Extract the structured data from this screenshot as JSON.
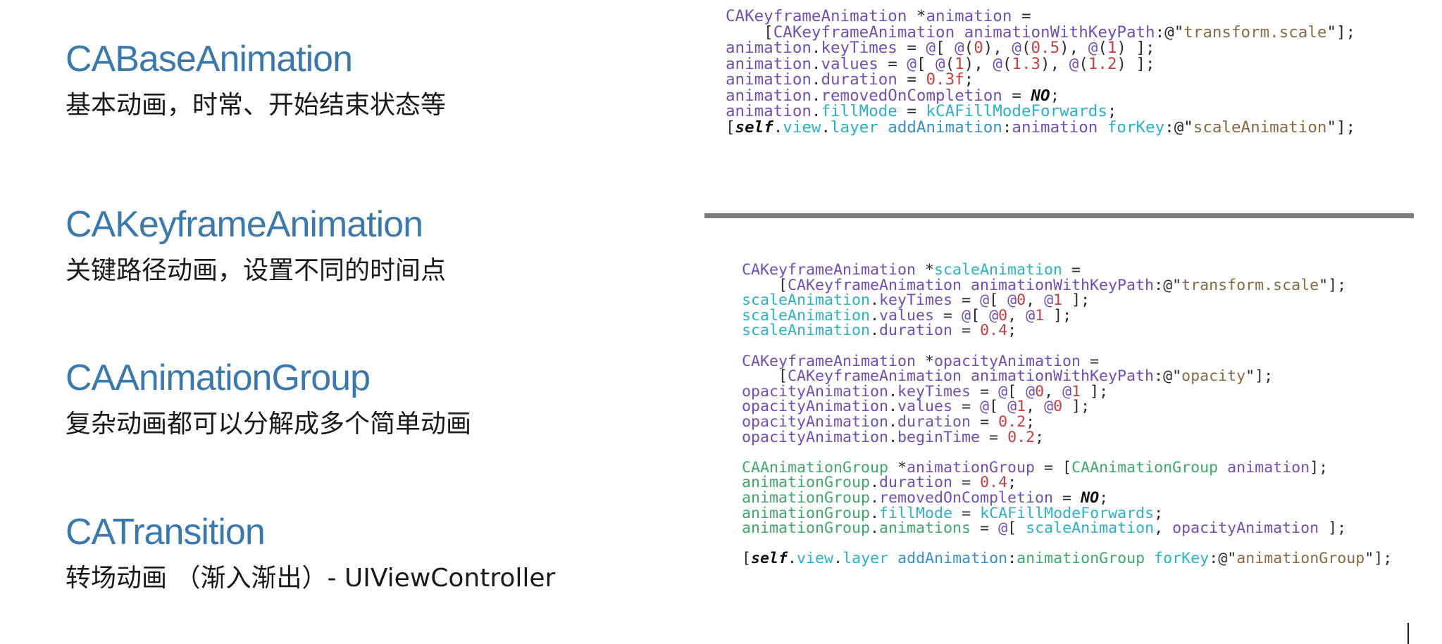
{
  "left_items": [
    {
      "title": "CABaseAnimation",
      "desc": "基本动画，时常、开始结束状态等"
    },
    {
      "title": "CAKeyframeAnimation",
      "desc": "关键路径动画，设置不同的时间点"
    },
    {
      "title": "CAAnimationGroup",
      "desc": "复杂动画都可以分解成多个简单动画"
    },
    {
      "title": "CATransition",
      "desc": "转场动画 （渐入渐出）- UIViewController"
    }
  ],
  "code_top": [
    [
      [
        "type",
        "CAKeyframeAnimation"
      ],
      [
        "plain",
        " *"
      ],
      [
        "type",
        "animation"
      ],
      [
        "plain",
        " ="
      ]
    ],
    [
      [
        "plain",
        "    ["
      ],
      [
        "type",
        "CAKeyframeAnimation"
      ],
      [
        "plain",
        " "
      ],
      [
        "type",
        "animationWithKeyPath"
      ],
      [
        "plain",
        ":@\""
      ],
      [
        "str",
        "transform.scale"
      ],
      [
        "plain",
        "\"];"
      ]
    ],
    [
      [
        "type",
        "animation"
      ],
      [
        "plain",
        "."
      ],
      [
        "type",
        "keyTimes"
      ],
      [
        "plain",
        " = "
      ],
      [
        "type",
        "@"
      ],
      [
        "plain",
        "[ "
      ],
      [
        "type",
        "@"
      ],
      [
        "plain",
        "("
      ],
      [
        "num",
        "0"
      ],
      [
        "plain",
        "), "
      ],
      [
        "type",
        "@"
      ],
      [
        "plain",
        "("
      ],
      [
        "num",
        "0.5"
      ],
      [
        "plain",
        "), "
      ],
      [
        "type",
        "@"
      ],
      [
        "plain",
        "("
      ],
      [
        "num",
        "1"
      ],
      [
        "plain",
        ") ];"
      ]
    ],
    [
      [
        "type",
        "animation"
      ],
      [
        "plain",
        "."
      ],
      [
        "type",
        "values"
      ],
      [
        "plain",
        " = "
      ],
      [
        "type",
        "@"
      ],
      [
        "plain",
        "[ "
      ],
      [
        "type",
        "@"
      ],
      [
        "plain",
        "("
      ],
      [
        "num",
        "1"
      ],
      [
        "plain",
        "), "
      ],
      [
        "type",
        "@"
      ],
      [
        "plain",
        "("
      ],
      [
        "num",
        "1.3"
      ],
      [
        "plain",
        "), "
      ],
      [
        "type",
        "@"
      ],
      [
        "plain",
        "("
      ],
      [
        "num",
        "1.2"
      ],
      [
        "plain",
        ") ];"
      ]
    ],
    [
      [
        "type",
        "animation"
      ],
      [
        "plain",
        "."
      ],
      [
        "type",
        "duration"
      ],
      [
        "plain",
        " = "
      ],
      [
        "num",
        "0.3f"
      ],
      [
        "plain",
        ";"
      ]
    ],
    [
      [
        "type",
        "animation"
      ],
      [
        "plain",
        "."
      ],
      [
        "type",
        "removedOnCompletion"
      ],
      [
        "plain",
        " = "
      ],
      [
        "kw",
        "NO"
      ],
      [
        "plain",
        ";"
      ]
    ],
    [
      [
        "type",
        "animation"
      ],
      [
        "plain",
        "."
      ],
      [
        "prop",
        "fillMode"
      ],
      [
        "plain",
        " = "
      ],
      [
        "prop",
        "kCAFillModeForwards"
      ],
      [
        "plain",
        ";"
      ]
    ],
    [
      [
        "plain",
        "["
      ],
      [
        "kw",
        "self"
      ],
      [
        "plain",
        "."
      ],
      [
        "prop",
        "view"
      ],
      [
        "plain",
        "."
      ],
      [
        "prop",
        "layer"
      ],
      [
        "plain",
        " "
      ],
      [
        "var",
        "addAnimation"
      ],
      [
        "plain",
        ":"
      ],
      [
        "type",
        "animation"
      ],
      [
        "plain",
        " "
      ],
      [
        "prop",
        "forKey"
      ],
      [
        "plain",
        ":@\""
      ],
      [
        "str",
        "scaleAnimation"
      ],
      [
        "plain",
        "\"];"
      ]
    ]
  ],
  "code_bottom": [
    [
      [
        "type",
        "CAKeyframeAnimation"
      ],
      [
        "plain",
        " *"
      ],
      [
        "prop",
        "scaleAnimation"
      ],
      [
        "plain",
        " ="
      ]
    ],
    [
      [
        "plain",
        "    ["
      ],
      [
        "type",
        "CAKeyframeAnimation"
      ],
      [
        "plain",
        " "
      ],
      [
        "type",
        "animationWithKeyPath"
      ],
      [
        "plain",
        ":@\""
      ],
      [
        "str",
        "transform.scale"
      ],
      [
        "plain",
        "\"];"
      ]
    ],
    [
      [
        "prop",
        "scaleAnimation"
      ],
      [
        "plain",
        "."
      ],
      [
        "type",
        "keyTimes"
      ],
      [
        "plain",
        " = "
      ],
      [
        "type",
        "@"
      ],
      [
        "plain",
        "[ "
      ],
      [
        "type",
        "@"
      ],
      [
        "num",
        "0"
      ],
      [
        "plain",
        ", "
      ],
      [
        "type",
        "@"
      ],
      [
        "num",
        "1"
      ],
      [
        "plain",
        " ];"
      ]
    ],
    [
      [
        "prop",
        "scaleAnimation"
      ],
      [
        "plain",
        "."
      ],
      [
        "type",
        "values"
      ],
      [
        "plain",
        " = "
      ],
      [
        "type",
        "@"
      ],
      [
        "plain",
        "[ "
      ],
      [
        "type",
        "@"
      ],
      [
        "num",
        "0"
      ],
      [
        "plain",
        ", "
      ],
      [
        "type",
        "@"
      ],
      [
        "num",
        "1"
      ],
      [
        "plain",
        " ];"
      ]
    ],
    [
      [
        "prop",
        "scaleAnimation"
      ],
      [
        "plain",
        "."
      ],
      [
        "type",
        "duration"
      ],
      [
        "plain",
        " = "
      ],
      [
        "num",
        "0.4"
      ],
      [
        "plain",
        ";"
      ]
    ],
    [],
    [
      [
        "type",
        "CAKeyframeAnimation"
      ],
      [
        "plain",
        " *"
      ],
      [
        "type",
        "opacityAnimation"
      ],
      [
        "plain",
        " ="
      ]
    ],
    [
      [
        "plain",
        "    ["
      ],
      [
        "type",
        "CAKeyframeAnimation"
      ],
      [
        "plain",
        " "
      ],
      [
        "type",
        "animationWithKeyPath"
      ],
      [
        "plain",
        ":@\""
      ],
      [
        "str",
        "opacity"
      ],
      [
        "plain",
        "\"];"
      ]
    ],
    [
      [
        "type",
        "opacityAnimation"
      ],
      [
        "plain",
        "."
      ],
      [
        "type",
        "keyTimes"
      ],
      [
        "plain",
        " = "
      ],
      [
        "type",
        "@"
      ],
      [
        "plain",
        "[ "
      ],
      [
        "type",
        "@"
      ],
      [
        "num",
        "0"
      ],
      [
        "plain",
        ", "
      ],
      [
        "type",
        "@"
      ],
      [
        "num",
        "1"
      ],
      [
        "plain",
        " ];"
      ]
    ],
    [
      [
        "type",
        "opacityAnimation"
      ],
      [
        "plain",
        "."
      ],
      [
        "type",
        "values"
      ],
      [
        "plain",
        " = "
      ],
      [
        "type",
        "@"
      ],
      [
        "plain",
        "[ "
      ],
      [
        "type",
        "@"
      ],
      [
        "num",
        "1"
      ],
      [
        "plain",
        ", "
      ],
      [
        "type",
        "@"
      ],
      [
        "num",
        "0"
      ],
      [
        "plain",
        " ];"
      ]
    ],
    [
      [
        "type",
        "opacityAnimation"
      ],
      [
        "plain",
        "."
      ],
      [
        "type",
        "duration"
      ],
      [
        "plain",
        " = "
      ],
      [
        "num",
        "0.2"
      ],
      [
        "plain",
        ";"
      ]
    ],
    [
      [
        "type",
        "opacityAnimation"
      ],
      [
        "plain",
        "."
      ],
      [
        "type",
        "beginTime"
      ],
      [
        "plain",
        " = "
      ],
      [
        "num",
        "0.2"
      ],
      [
        "plain",
        ";"
      ]
    ],
    [],
    [
      [
        "green",
        "CAAnimationGroup"
      ],
      [
        "plain",
        " *"
      ],
      [
        "type",
        "animationGroup"
      ],
      [
        "plain",
        " = ["
      ],
      [
        "green",
        "CAAnimationGroup"
      ],
      [
        "plain",
        " "
      ],
      [
        "type",
        "animation"
      ],
      [
        "plain",
        "];"
      ]
    ],
    [
      [
        "green",
        "animationGroup"
      ],
      [
        "plain",
        "."
      ],
      [
        "type",
        "duration"
      ],
      [
        "plain",
        " = "
      ],
      [
        "num",
        "0.4"
      ],
      [
        "plain",
        ";"
      ]
    ],
    [
      [
        "green",
        "animationGroup"
      ],
      [
        "plain",
        "."
      ],
      [
        "type",
        "removedOnCompletion"
      ],
      [
        "plain",
        " = "
      ],
      [
        "kw",
        "NO"
      ],
      [
        "plain",
        ";"
      ]
    ],
    [
      [
        "green",
        "animationGroup"
      ],
      [
        "plain",
        "."
      ],
      [
        "prop",
        "fillMode"
      ],
      [
        "plain",
        " = "
      ],
      [
        "prop",
        "kCAFillModeForwards"
      ],
      [
        "plain",
        ";"
      ]
    ],
    [
      [
        "green",
        "animationGroup"
      ],
      [
        "plain",
        "."
      ],
      [
        "green",
        "animations"
      ],
      [
        "plain",
        " = "
      ],
      [
        "type",
        "@"
      ],
      [
        "plain",
        "[ "
      ],
      [
        "prop",
        "scaleAnimation"
      ],
      [
        "plain",
        ", "
      ],
      [
        "type",
        "opacityAnimation"
      ],
      [
        "plain",
        " ];"
      ]
    ],
    [],
    [
      [
        "plain",
        "["
      ],
      [
        "kw",
        "self"
      ],
      [
        "plain",
        "."
      ],
      [
        "prop",
        "view"
      ],
      [
        "plain",
        "."
      ],
      [
        "prop",
        "layer"
      ],
      [
        "plain",
        " "
      ],
      [
        "var",
        "addAnimation"
      ],
      [
        "plain",
        ":"
      ],
      [
        "green",
        "animationGroup"
      ],
      [
        "plain",
        " "
      ],
      [
        "prop",
        "forKey"
      ],
      [
        "plain",
        ":@\""
      ],
      [
        "str",
        "animationGroup"
      ],
      [
        "plain",
        "\"];"
      ]
    ]
  ]
}
